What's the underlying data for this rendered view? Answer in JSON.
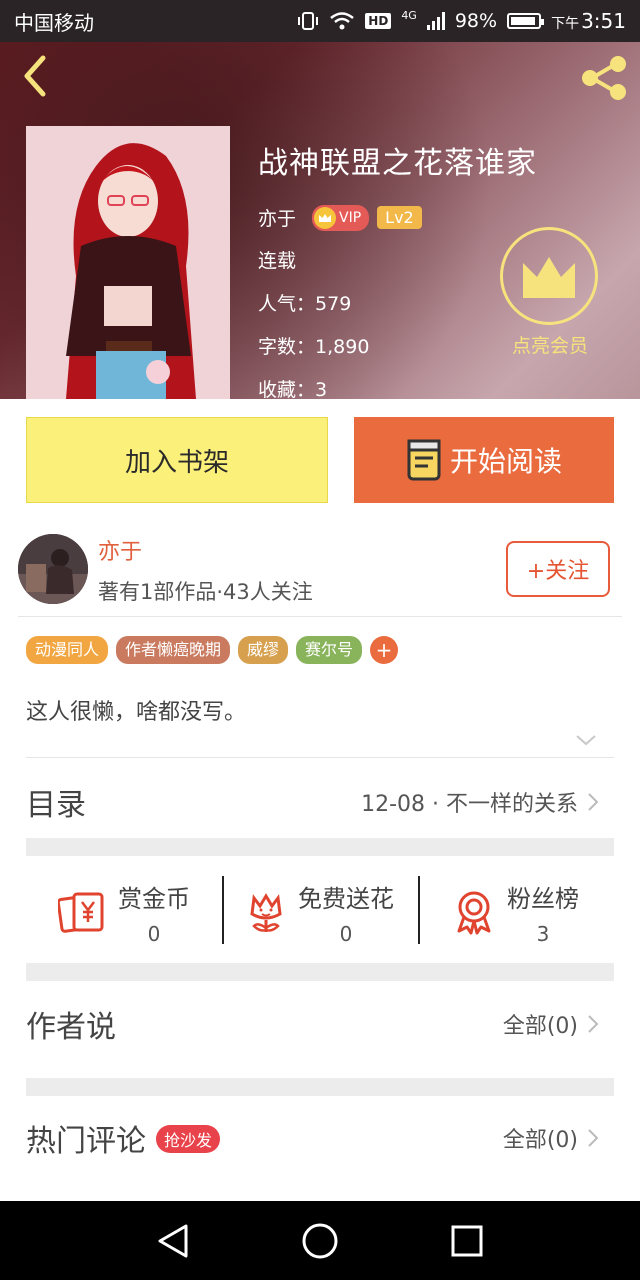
{
  "status_bar": {
    "carrier": "中国移动",
    "network": "4G",
    "hd": "HD",
    "battery": "98%",
    "time_prefix": "下午",
    "time": "3:51"
  },
  "header": {
    "back_icon": "chevron-left-icon",
    "share_icon": "share-icon"
  },
  "book": {
    "title": "战神联盟之花落谁家",
    "author": "亦于",
    "vip_label": "VIP",
    "level_label": "Lv2",
    "status": "连载",
    "popularity_label": "人气：",
    "popularity": "579",
    "word_count_label": "字数：",
    "word_count": "1,890",
    "favorites_label": "收藏：",
    "favorites": "3"
  },
  "member": {
    "label": "点亮会员",
    "icon": "crown-icon"
  },
  "actions": {
    "add_shelf": "加入书架",
    "start_reading": "开始阅读"
  },
  "author_card": {
    "name": "亦于",
    "meta": "著有1部作品·43人关注",
    "follow": "+关注"
  },
  "tags": [
    {
      "label": "动漫同人",
      "color": "#f2a641"
    },
    {
      "label": "作者懒癌晚期",
      "color": "#c97a5f"
    },
    {
      "label": "威缪",
      "color": "#d6a04e"
    },
    {
      "label": "赛尔号",
      "color": "#89b45c"
    }
  ],
  "tag_add": "+",
  "bio": "这人很懒，啥都没写。",
  "catalog": {
    "label": "目录",
    "latest": "12-08 · 不一样的关系"
  },
  "rewards": [
    {
      "label": "赏金币",
      "value": "0",
      "icon": "red-envelope-yen-icon"
    },
    {
      "label": "免费送花",
      "value": "0",
      "icon": "flower-icon"
    },
    {
      "label": "粉丝榜",
      "value": "3",
      "icon": "medal-icon"
    }
  ],
  "author_says": {
    "label": "作者说",
    "all": "全部(0)"
  },
  "hot_comments": {
    "label": "热门评论",
    "badge": "抢沙发",
    "all": "全部(0)"
  },
  "colors": {
    "accent_orange": "#ea6b3e",
    "shelf_yellow": "#fbf07a",
    "author_red": "#e0603e",
    "member_gold": "#f7e37d"
  }
}
